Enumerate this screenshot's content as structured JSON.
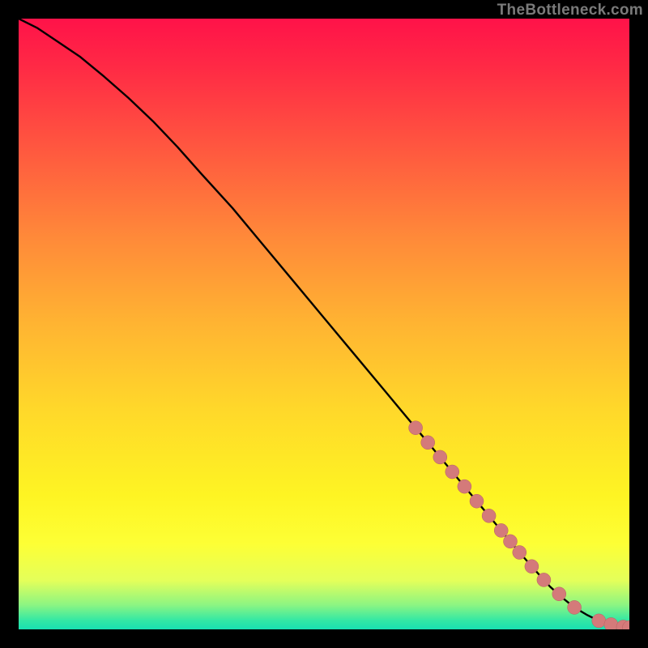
{
  "watermark": "TheBottleneck.com",
  "colors": {
    "line": "#000000",
    "dot_fill": "#d47a7a",
    "dot_stroke": "#b46060"
  },
  "chart_data": {
    "type": "line",
    "title": "",
    "xlabel": "",
    "ylabel": "",
    "xlim": [
      0,
      100
    ],
    "ylim": [
      0,
      100
    ],
    "grid": false,
    "legend": "none",
    "series": [
      {
        "name": "curve",
        "x": [
          0,
          3,
          6,
          10,
          14,
          18,
          22,
          26,
          30,
          35,
          40,
          45,
          50,
          55,
          60,
          65,
          70,
          73,
          76,
          79,
          82,
          85,
          87,
          89,
          91,
          93,
          95,
          97,
          99,
          100
        ],
        "y": [
          100,
          98.5,
          96.5,
          93.8,
          90.5,
          87,
          83.2,
          79,
          74.5,
          69,
          63,
          57,
          51,
          45,
          39,
          33,
          27,
          23.4,
          19.8,
          16.2,
          12.6,
          9.2,
          7.0,
          5.2,
          3.6,
          2.4,
          1.4,
          0.8,
          0.4,
          0.3
        ]
      }
    ],
    "highlight_points": {
      "name": "dots",
      "x": [
        65,
        67,
        69,
        71,
        73,
        75,
        77,
        79,
        80.5,
        82,
        84,
        86,
        88.5,
        91,
        95,
        97,
        99,
        100
      ],
      "y": [
        33,
        30.6,
        28.2,
        25.8,
        23.4,
        21.0,
        18.6,
        16.2,
        14.4,
        12.6,
        10.3,
        8.1,
        5.8,
        3.6,
        1.4,
        0.8,
        0.4,
        0.3
      ]
    }
  }
}
